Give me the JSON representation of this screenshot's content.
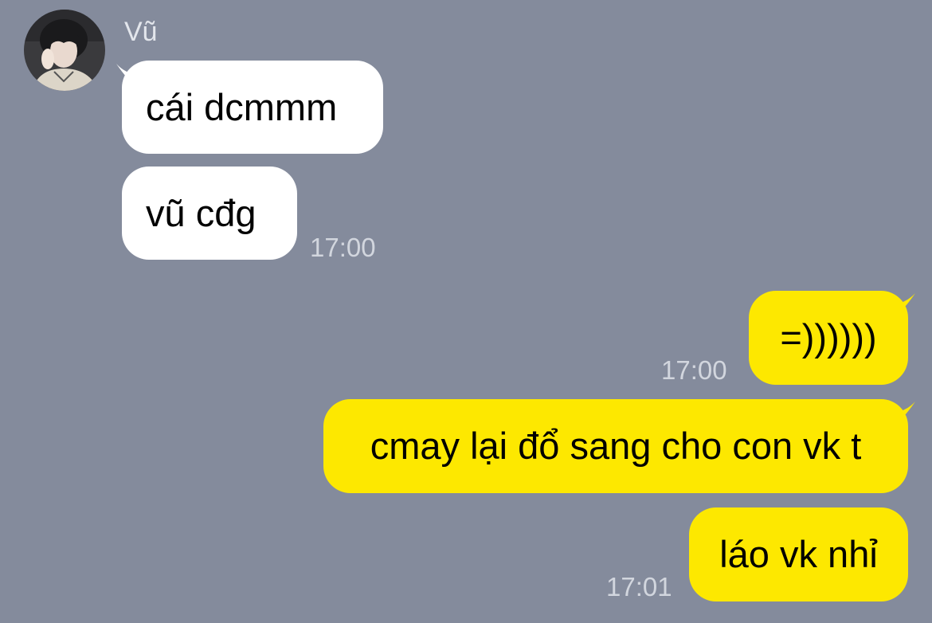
{
  "sender": {
    "name": "Vũ"
  },
  "messages_in": [
    {
      "text": "cái dcmmm"
    },
    {
      "text": "vũ cđg",
      "time": "17:00"
    }
  ],
  "messages_out": [
    {
      "text": "=))))))",
      "time": "17:00"
    },
    {
      "text": "cmay lại đổ sang cho con vk t"
    },
    {
      "text": "láo vk nhỉ",
      "time": "17:01"
    }
  ],
  "colors": {
    "background": "#848b9c",
    "incoming_bubble": "#ffffff",
    "outgoing_bubble": "#fde800",
    "timestamp": "#d2d6de",
    "sender_name": "#e3e6ec"
  }
}
